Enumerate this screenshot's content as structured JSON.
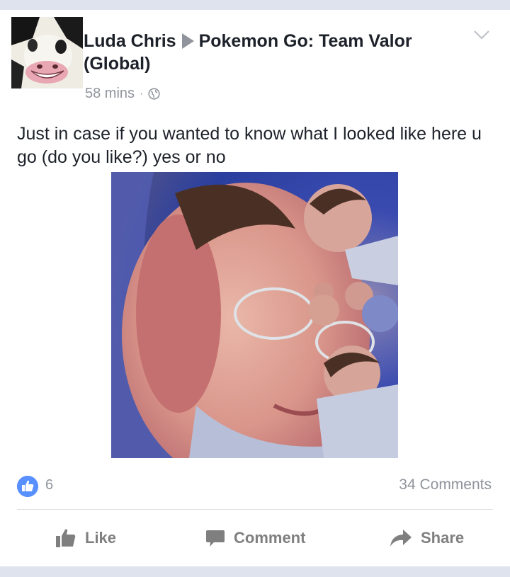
{
  "post": {
    "author": "Luda Chris",
    "group": "Pokemon Go: Team Valor (Global)",
    "time": "58 mins",
    "separator": "·",
    "text": "Just in case if you wanted to know what I looked like here u go (do you like?) yes or no"
  },
  "stats": {
    "likes": "6",
    "comments": "34 Comments"
  },
  "actions": {
    "like": "Like",
    "comment": "Comment",
    "share": "Share"
  },
  "icons": {
    "privacy": "globe-icon",
    "menu": "chevron-down-icon",
    "reaction": "thumbs-up-icon"
  },
  "colors": {
    "reaction_blue": "#5890ff",
    "muted_text": "#90949c",
    "action_text": "#7f7f7f"
  }
}
